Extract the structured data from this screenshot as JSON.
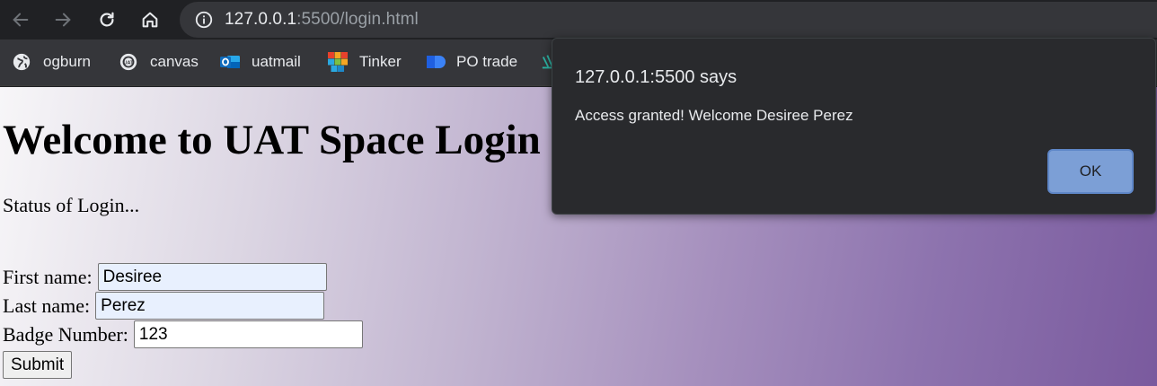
{
  "browser": {
    "url_host": "127.0.0.1",
    "url_rest": ":5500/login.html"
  },
  "bookmarks": [
    {
      "label": "ogburn",
      "icon": "globe-icon"
    },
    {
      "label": "canvas",
      "icon": "canvas-logo-icon"
    },
    {
      "label": "uatmail",
      "icon": "outlook-icon"
    },
    {
      "label": "Tinker",
      "icon": "tinkercad-icon"
    },
    {
      "label": "PO trade",
      "icon": "po-trade-icon"
    }
  ],
  "page": {
    "heading": "Welcome to UAT Space Login",
    "status": "Status of Login...",
    "first_name_label": "First name:",
    "first_name_value": "Desiree",
    "last_name_label": "Last name:",
    "last_name_value": "Perez",
    "badge_label": "Badge Number:",
    "badge_value": "123",
    "submit_label": "Submit"
  },
  "dialog": {
    "title": "127.0.0.1:5500 says",
    "message": "Access granted! Welcome Desiree Perez",
    "ok_label": "OK"
  },
  "colors": {
    "toolbar_bg": "#202124",
    "bookmark_bar_bg": "#35363a",
    "dialog_bg": "#292a2d",
    "ok_button": "#7c9fd6",
    "autofill_bg": "#e8f0fe"
  }
}
